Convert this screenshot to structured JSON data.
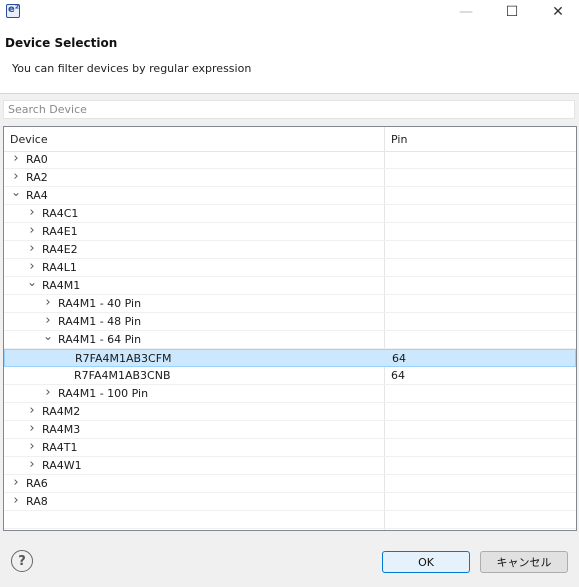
{
  "window": {
    "app_icon_glyph": "e²",
    "minimize_glyph": "—",
    "maximize_glyph": "☐",
    "close_glyph": "✕"
  },
  "header": {
    "title": "Device Selection",
    "subtitle": "You can filter devices by regular expression"
  },
  "search": {
    "placeholder": "Search Device",
    "value": ""
  },
  "tree": {
    "columns": [
      "Device",
      "Pin"
    ],
    "rows": [
      {
        "label": "RA0",
        "level": 0,
        "state": "collapsed",
        "pin": ""
      },
      {
        "label": "RA2",
        "level": 0,
        "state": "collapsed",
        "pin": ""
      },
      {
        "label": "RA4",
        "level": 0,
        "state": "expanded",
        "pin": ""
      },
      {
        "label": "RA4C1",
        "level": 1,
        "state": "collapsed",
        "pin": ""
      },
      {
        "label": "RA4E1",
        "level": 1,
        "state": "collapsed",
        "pin": ""
      },
      {
        "label": "RA4E2",
        "level": 1,
        "state": "collapsed",
        "pin": ""
      },
      {
        "label": "RA4L1",
        "level": 1,
        "state": "collapsed",
        "pin": ""
      },
      {
        "label": "RA4M1",
        "level": 1,
        "state": "expanded",
        "pin": ""
      },
      {
        "label": "RA4M1 - 40 Pin",
        "level": 2,
        "state": "collapsed",
        "pin": ""
      },
      {
        "label": "RA4M1 - 48 Pin",
        "level": 2,
        "state": "collapsed",
        "pin": ""
      },
      {
        "label": "RA4M1 - 64 Pin",
        "level": 2,
        "state": "expanded",
        "pin": ""
      },
      {
        "label": "R7FA4M1AB3CFM",
        "level": 3,
        "state": "leaf",
        "pin": "64",
        "selected": true
      },
      {
        "label": "R7FA4M1AB3CNB",
        "level": 3,
        "state": "leaf",
        "pin": "64"
      },
      {
        "label": "RA4M1 - 100 Pin",
        "level": 2,
        "state": "collapsed",
        "pin": ""
      },
      {
        "label": "RA4M2",
        "level": 1,
        "state": "collapsed",
        "pin": ""
      },
      {
        "label": "RA4M3",
        "level": 1,
        "state": "collapsed",
        "pin": ""
      },
      {
        "label": "RA4T1",
        "level": 1,
        "state": "collapsed",
        "pin": ""
      },
      {
        "label": "RA4W1",
        "level": 1,
        "state": "collapsed",
        "pin": ""
      },
      {
        "label": "RA6",
        "level": 0,
        "state": "collapsed",
        "pin": ""
      },
      {
        "label": "RA8",
        "level": 0,
        "state": "collapsed",
        "pin": ""
      },
      {
        "label": "",
        "level": 0,
        "state": "leaf",
        "pin": ""
      }
    ]
  },
  "footer": {
    "help_glyph": "?",
    "ok_label": "OK",
    "cancel_label": "キャンセル"
  },
  "colors": {
    "selection_bg": "#cce8ff",
    "selection_border": "#99d1ff",
    "ok_border": "#0078d7"
  }
}
